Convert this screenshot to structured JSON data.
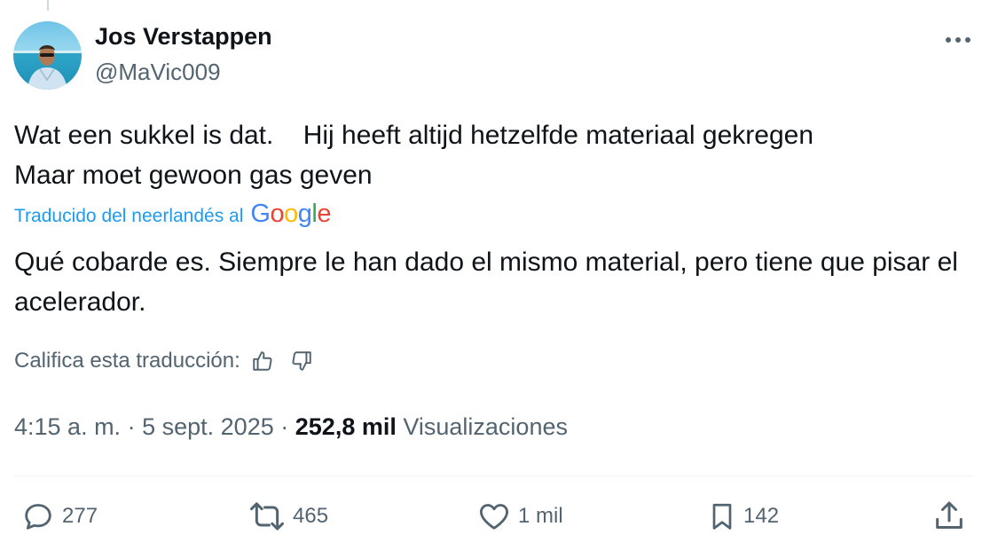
{
  "tweet": {
    "author": {
      "display_name": "Jos Verstappen",
      "handle": "@MaVic009"
    },
    "original_text": "Wat een sukkel is dat.    Hij heeft altijd hetzelfde materiaal gekregen\nMaar moet gewoon gas geven",
    "translation_label": "Traducido del neerlandés al",
    "translation_provider": "Google",
    "translated_text": "Qué cobarde es. Siempre le han dado el mismo material, pero tiene que pisar el acelerador.",
    "rate_label": "Califica esta traducción:",
    "meta": {
      "time": "4:15 a. m.",
      "separator": "·",
      "date": "5 sept. 2025",
      "views_count": "252,8 mil",
      "views_label": "Visualizaciones"
    },
    "actions": {
      "replies": "277",
      "reposts": "465",
      "likes": "1 mil",
      "bookmarks": "142"
    }
  },
  "icons": {
    "more": "more-horizontal-icon",
    "reply": "speech-bubble-icon",
    "repost": "repost-arrows-icon",
    "like": "heart-icon",
    "bookmark": "bookmark-icon",
    "share": "share-upload-icon",
    "thumbs_up": "thumbs-up-icon",
    "thumbs_down": "thumbs-down-icon"
  },
  "colors": {
    "text": "#0f1419",
    "secondary": "#536471",
    "link": "#1d9bf0",
    "google_blue": "#4285F4",
    "google_red": "#EA4335",
    "google_yellow": "#FBBC05",
    "google_green": "#34A853"
  }
}
